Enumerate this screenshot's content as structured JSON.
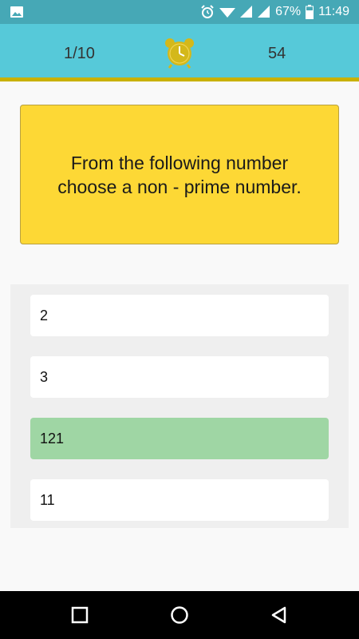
{
  "status_bar": {
    "battery": "67%",
    "time": "11:49",
    "icons": [
      "image-icon",
      "alarm-icon",
      "wifi-icon",
      "signal-icon",
      "signal-icon",
      "battery-icon"
    ]
  },
  "header": {
    "question_counter": "1/10",
    "timer_value": "54",
    "timer_icon": "alarm-clock-icon",
    "accent_color": "#56c9d9",
    "timer_color": "#d4b81a"
  },
  "question": {
    "text": "From the following number choose a non - prime number."
  },
  "options": [
    {
      "label": "2",
      "state": "default"
    },
    {
      "label": "3",
      "state": "default"
    },
    {
      "label": "121",
      "state": "correct"
    },
    {
      "label": "11",
      "state": "default"
    }
  ],
  "nav": {
    "icons": [
      "recents-square-icon",
      "home-circle-icon",
      "back-triangle-icon"
    ]
  }
}
